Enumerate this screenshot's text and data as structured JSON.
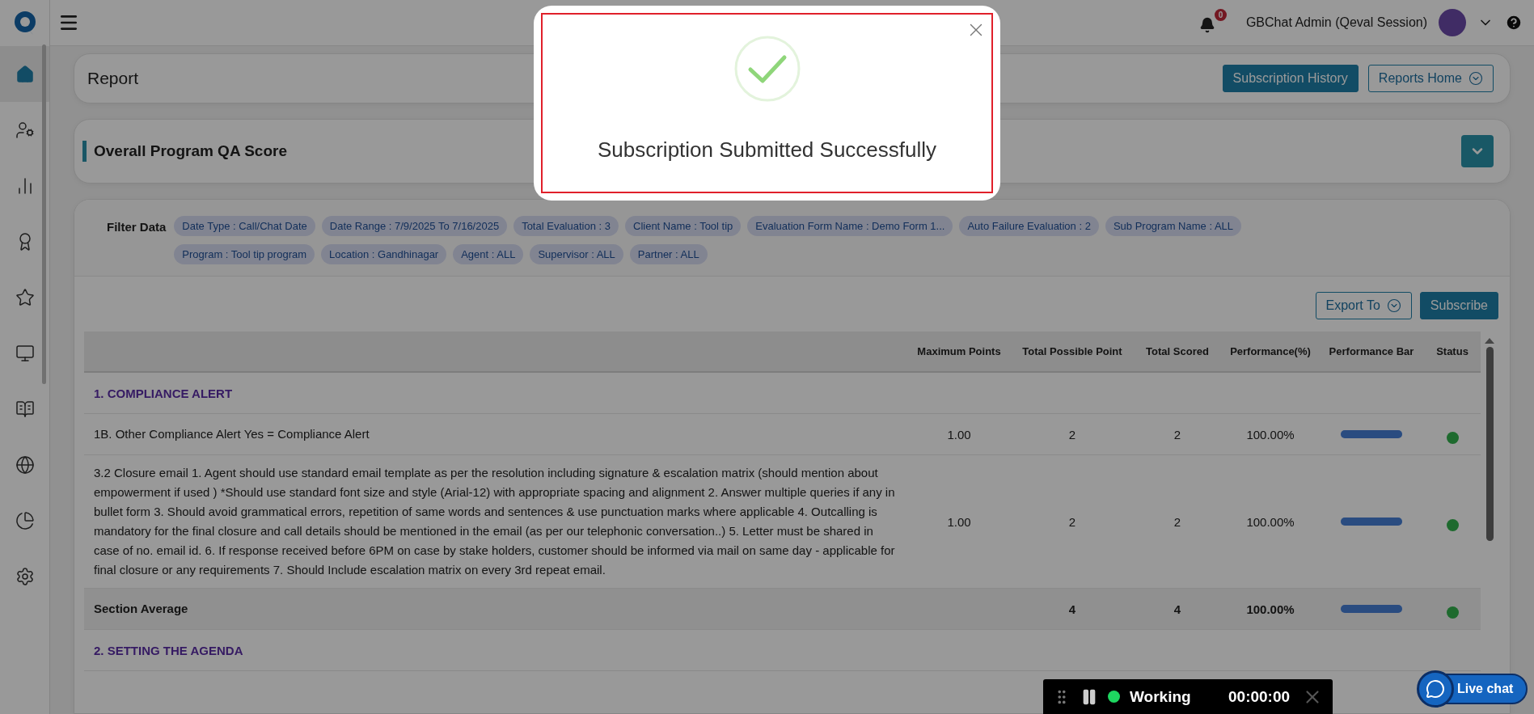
{
  "sidebar": {
    "items": [
      {
        "selected": true
      },
      {
        "selected": false
      },
      {
        "selected": false
      },
      {
        "selected": false
      },
      {
        "selected": false
      },
      {
        "selected": false
      },
      {
        "selected": false
      },
      {
        "selected": false
      },
      {
        "selected": false
      },
      {
        "selected": false
      }
    ]
  },
  "topbar": {
    "notifications": "0",
    "user": "GBChat Admin (Qeval Session)"
  },
  "report_header": {
    "title": "Report",
    "buttons": [
      {
        "label": "Subscription History",
        "kind": "primary"
      },
      {
        "label": "Reports Home",
        "kind": "outline"
      }
    ]
  },
  "score_panel": {
    "title": "Overall Program QA Score"
  },
  "filters": {
    "label": "Filter Data",
    "chips": [
      "Date Type : Call/Chat Date",
      "Date Range : 7/9/2025 To 7/16/2025",
      "Total Evaluation : 3",
      "Client Name : Tool tip",
      "Evaluation Form Name : Demo Form 1...",
      "Auto Failure Evaluation : 2",
      "Sub Program Name : ALL",
      "Program : Tool tip program",
      "Location : Gandhinagar",
      "Agent : ALL",
      "Supervisor : ALL",
      "Partner : ALL"
    ]
  },
  "actions": [
    {
      "label": "Export To",
      "kind": "outline"
    },
    {
      "label": "Subscribe",
      "kind": "primary"
    }
  ],
  "table": {
    "columns": [
      "Maximum Points",
      "Total Possible Point",
      "Total Scored",
      "Performance(%)",
      "Performance Bar",
      "Status"
    ],
    "rows": [
      {
        "kind": "section",
        "title": "1. COMPLIANCE ALERT"
      },
      {
        "kind": "item",
        "title": "1B. Other Compliance Alert Yes = Compliance Alert",
        "maximum": "1.00",
        "possible": "2",
        "scored": "2",
        "performance": "100.00%",
        "level": 1,
        "color": "#1e6a2e"
      },
      {
        "kind": "item",
        "title": "3.2 Closure email 1. Agent should use standard email template as per the resolution including signature & escalation matrix (should mention about empowerment if used ) *Should use standard font size and style (Arial-12) with appropriate spacing and alignment 2. Answer multiple queries if any in bullet form 3. Should avoid grammatical errors, repetition of same words and sentences & use punctuation marks where applicable 4. Outcalling is mandatory for the final closure and call details should be mentioned in the email (as per our telephonic conversation..) 5. Letter must be shared in case of no. email id. 6. If response received before 6PM on case by stake holders, customer should be informed via mail on same day - applicable for final closure or any requirements 7. Should Include escalation matrix on every 3rd repeat email.",
        "maximum": "1.00",
        "possible": "2",
        "scored": "2",
        "performance": "100.00%",
        "level": 1,
        "color": "#1e6a2e"
      },
      {
        "kind": "average",
        "title": "Section Average",
        "possible": "4",
        "scored": "4",
        "performance": "100.00%",
        "level": 1,
        "color": "#1e6a2e"
      },
      {
        "kind": "section",
        "title": "2. SETTING THE AGENDA"
      }
    ]
  },
  "modal": {
    "message": "Subscription Submitted Successfully"
  },
  "timer": {
    "status": "Working",
    "time": "00:00:00"
  },
  "live_chat": {
    "label": "Live chat"
  }
}
